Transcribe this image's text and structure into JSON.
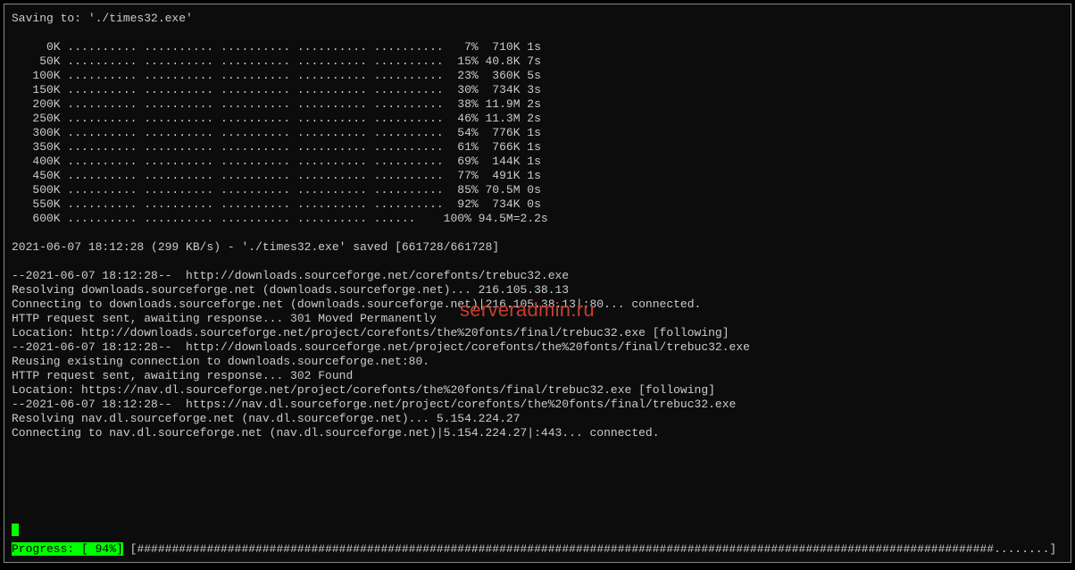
{
  "saving_line": "Saving to: './times32.exe'",
  "rows": [
    {
      "kb": "     0K",
      "pct": "  7%",
      "speed": " 710K",
      "eta": "1s"
    },
    {
      "kb": "    50K",
      "pct": " 15%",
      "speed": "40.8K",
      "eta": "7s"
    },
    {
      "kb": "   100K",
      "pct": " 23%",
      "speed": " 360K",
      "eta": "5s"
    },
    {
      "kb": "   150K",
      "pct": " 30%",
      "speed": " 734K",
      "eta": "3s"
    },
    {
      "kb": "   200K",
      "pct": " 38%",
      "speed": "11.9M",
      "eta": "2s"
    },
    {
      "kb": "   250K",
      "pct": " 46%",
      "speed": "11.3M",
      "eta": "2s"
    },
    {
      "kb": "   300K",
      "pct": " 54%",
      "speed": " 776K",
      "eta": "1s"
    },
    {
      "kb": "   350K",
      "pct": " 61%",
      "speed": " 766K",
      "eta": "1s"
    },
    {
      "kb": "   400K",
      "pct": " 69%",
      "speed": " 144K",
      "eta": "1s"
    },
    {
      "kb": "   450K",
      "pct": " 77%",
      "speed": " 491K",
      "eta": "1s"
    },
    {
      "kb": "   500K",
      "pct": " 85%",
      "speed": "70.5M",
      "eta": "0s"
    },
    {
      "kb": "   550K",
      "pct": " 92%",
      "speed": " 734K",
      "eta": "0s"
    }
  ],
  "last_row": "   600K .......... .......... .......... .......... ......    100% 94.5M=2.2s",
  "summary": "2021-06-07 18:12:28 (299 KB/s) - './times32.exe' saved [661728/661728]",
  "lines": [
    "--2021-06-07 18:12:28--  http://downloads.sourceforge.net/corefonts/trebuc32.exe",
    "Resolving downloads.sourceforge.net (downloads.sourceforge.net)... 216.105.38.13",
    "Connecting to downloads.sourceforge.net (downloads.sourceforge.net)|216.105.38.13|:80... connected.",
    "HTTP request sent, awaiting response... 301 Moved Permanently",
    "Location: http://downloads.sourceforge.net/project/corefonts/the%20fonts/final/trebuc32.exe [following]",
    "--2021-06-07 18:12:28--  http://downloads.sourceforge.net/project/corefonts/the%20fonts/final/trebuc32.exe",
    "Reusing existing connection to downloads.sourceforge.net:80.",
    "HTTP request sent, awaiting response... 302 Found",
    "Location: https://nav.dl.sourceforge.net/project/corefonts/the%20fonts/final/trebuc32.exe [following]",
    "--2021-06-07 18:12:28--  https://nav.dl.sourceforge.net/project/corefonts/the%20fonts/final/trebuc32.exe",
    "Resolving nav.dl.sourceforge.net (nav.dl.sourceforge.net)... 5.154.224.27",
    "Connecting to nav.dl.sourceforge.net (nav.dl.sourceforge.net)|5.154.224.27|:443... connected."
  ],
  "progress": {
    "label": "Progress: [ 94%]",
    "bar_open": " [",
    "bar_fill": "###########################################################################################################################",
    "bar_empty": "........",
    "bar_close": "]"
  },
  "watermark": "serveradmin.ru"
}
